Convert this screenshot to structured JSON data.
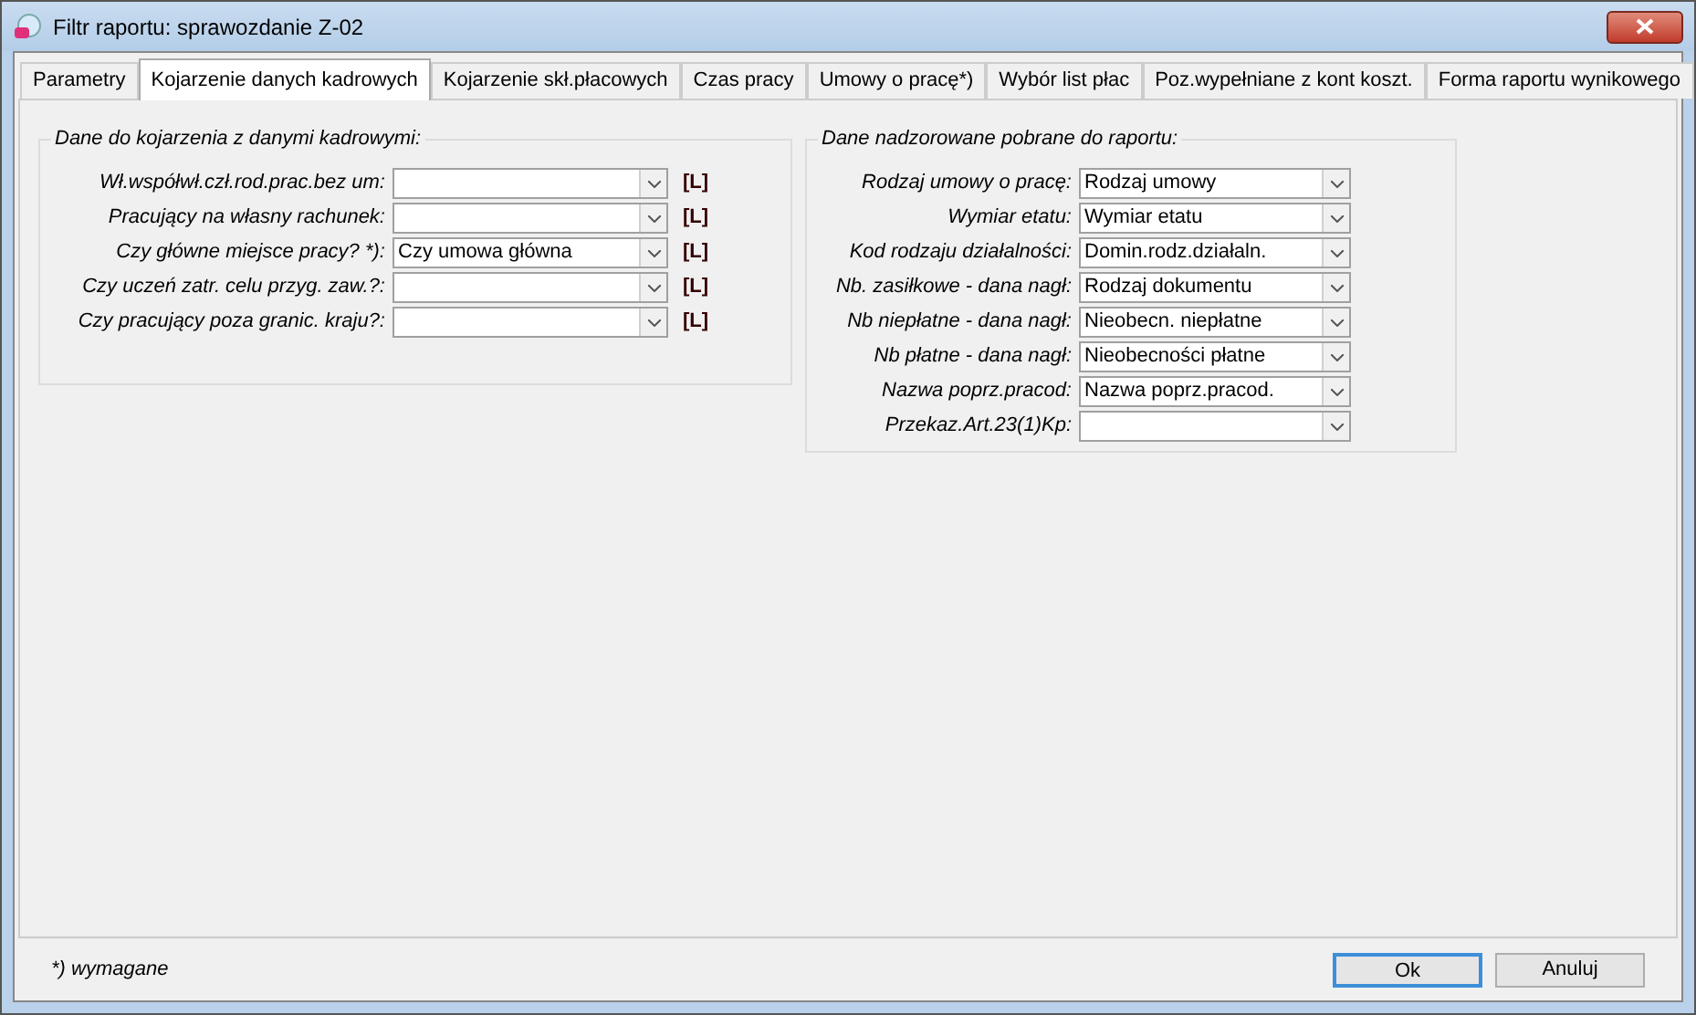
{
  "window": {
    "title": "Filtr raportu: sprawozdanie Z-02"
  },
  "tabs": [
    {
      "label": "Parametry",
      "selected": false
    },
    {
      "label": "Kojarzenie danych kadrowych",
      "selected": true
    },
    {
      "label": "Kojarzenie skł.płacowych",
      "selected": false
    },
    {
      "label": "Czas pracy",
      "selected": false
    },
    {
      "label": "Umowy o pracę*)",
      "selected": false
    },
    {
      "label": "Wybór list płac",
      "selected": false
    },
    {
      "label": "Poz.wypełniane z kont koszt.",
      "selected": false
    },
    {
      "label": "Forma raportu wynikowego",
      "selected": false
    }
  ],
  "left_group": {
    "title": "Dane do kojarzenia z danymi kadrowymi:",
    "rows": [
      {
        "label": "Wł.współwł.czł.rod.prac.bez um:",
        "value": "",
        "tag": "[L]"
      },
      {
        "label": "Pracujący na własny rachunek:",
        "value": "",
        "tag": "[L]"
      },
      {
        "label": "Czy główne miejsce pracy? *):",
        "value": "Czy umowa główna",
        "tag": "[L]"
      },
      {
        "label": "Czy uczeń zatr. celu przyg. zaw.?:",
        "value": "",
        "tag": "[L]"
      },
      {
        "label": "Czy pracujący poza granic. kraju?:",
        "value": "",
        "tag": "[L]"
      }
    ]
  },
  "right_group": {
    "title": "Dane nadzorowane pobrane do raportu:",
    "rows": [
      {
        "label": "Rodzaj umowy o pracę:",
        "value": "Rodzaj umowy"
      },
      {
        "label": "Wymiar etatu:",
        "value": "Wymiar etatu"
      },
      {
        "label": "Kod rodzaju działalności:",
        "value": "Domin.rodz.działaln."
      },
      {
        "label": "Nb. zasiłkowe - dana nagł:",
        "value": "Rodzaj dokumentu"
      },
      {
        "label": "Nb niepłatne - dana nagł:",
        "value": "Nieobecn. niepłatne"
      },
      {
        "label": "Nb płatne - dana nagł:",
        "value": "Nieobecności płatne"
      },
      {
        "label": "Nazwa poprz.pracod:",
        "value": "Nazwa poprz.pracod."
      },
      {
        "label": "Przekaz.Art.23(1)Kp:",
        "value": ""
      }
    ]
  },
  "footer": {
    "note": "*) wymagane",
    "buttons": [
      {
        "label": "Ok",
        "default": true
      },
      {
        "label": "Anuluj",
        "default": false
      }
    ]
  }
}
